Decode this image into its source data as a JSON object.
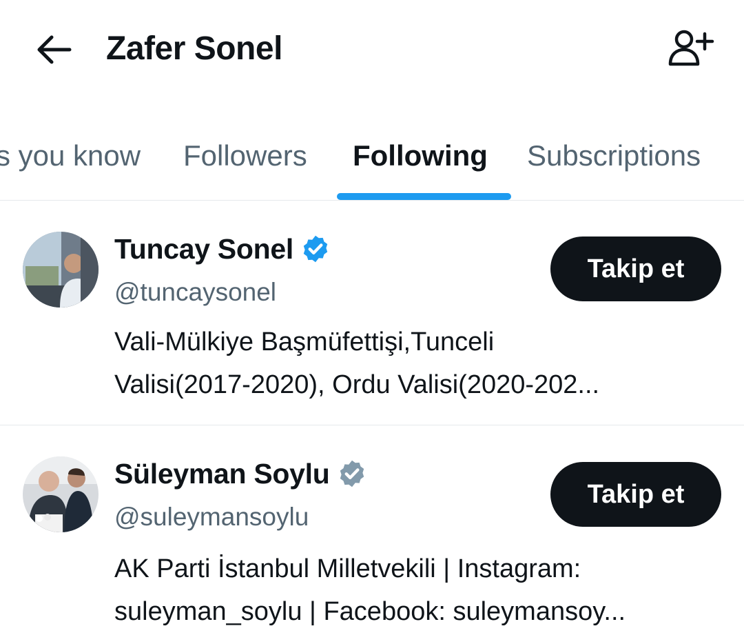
{
  "header": {
    "title": "Zafer Sonel"
  },
  "tabs": [
    {
      "label": "s you know",
      "active": false
    },
    {
      "label": "Followers",
      "active": false
    },
    {
      "label": "Following",
      "active": true
    },
    {
      "label": "Subscriptions",
      "active": false
    }
  ],
  "users": [
    {
      "name": "Tuncay Sonel",
      "handle": "@tuncaysonel",
      "verified_color": "#1d9bf0",
      "bio_lines": [
        "Vali-Mülkiye Başmüfettişi,Tunceli",
        "Valisi(2017-2020), Ordu Valisi(2020-202..."
      ],
      "follow_label": "Takip et"
    },
    {
      "name": "Süleyman Soylu",
      "handle": "@suleymansoylu",
      "verified_color": "#829aab",
      "bio_lines": [
        "AK Parti İstanbul Milletvekili | Instagram:",
        "suleyman_soylu | Facebook: suleymansoy..."
      ],
      "follow_label": "Takip et"
    }
  ],
  "colors": {
    "accent": "#1d9bf0",
    "text": "#0f1419",
    "secondary": "#536471"
  }
}
